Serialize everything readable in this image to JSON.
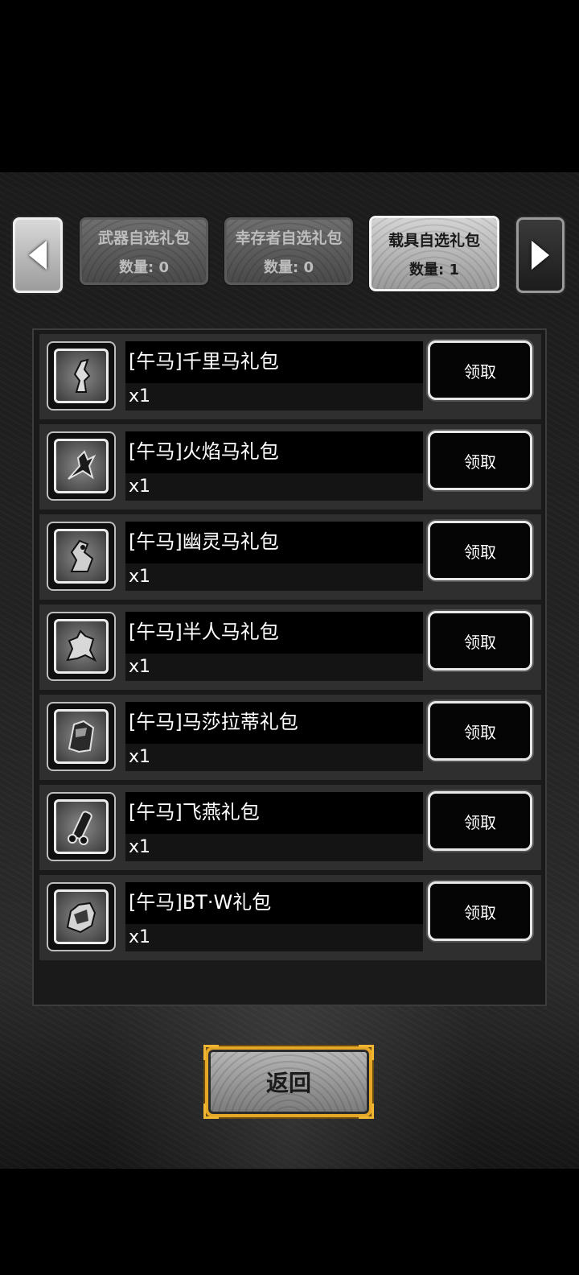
{
  "nav": {
    "prev_icon": "chevron-left-icon",
    "next_icon": "chevron-right-icon"
  },
  "tabs": [
    {
      "title": "武器自选礼包",
      "count": "数量: 0"
    },
    {
      "title": "幸存者自选礼包",
      "count": "数量: 0"
    },
    {
      "title": "载具自选礼包",
      "count": "数量: 1"
    }
  ],
  "items": [
    {
      "name": "[午马]千里马礼包",
      "qty": "x1",
      "button": "领取",
      "icon": "horse-rider-icon"
    },
    {
      "name": "[午马]火焰马礼包",
      "qty": "x1",
      "button": "领取",
      "icon": "fire-horse-icon"
    },
    {
      "name": "[午马]幽灵马礼包",
      "qty": "x1",
      "button": "领取",
      "icon": "ghost-horse-icon"
    },
    {
      "name": "[午马]半人马礼包",
      "qty": "x1",
      "button": "领取",
      "icon": "centaur-icon"
    },
    {
      "name": "[午马]马莎拉蒂礼包",
      "qty": "x1",
      "button": "领取",
      "icon": "car-icon"
    },
    {
      "name": "[午马]飞燕礼包",
      "qty": "x1",
      "button": "领取",
      "icon": "motorbike-icon"
    },
    {
      "name": "[午马]BT·W礼包",
      "qty": "x1",
      "button": "领取",
      "icon": "mech-vehicle-icon"
    }
  ],
  "footer": {
    "back_label": "返回"
  },
  "colors": {
    "accent_gold": "#e7a726",
    "panel_bg": "#1a1a1a",
    "row_bg": "#2f2f2f"
  }
}
